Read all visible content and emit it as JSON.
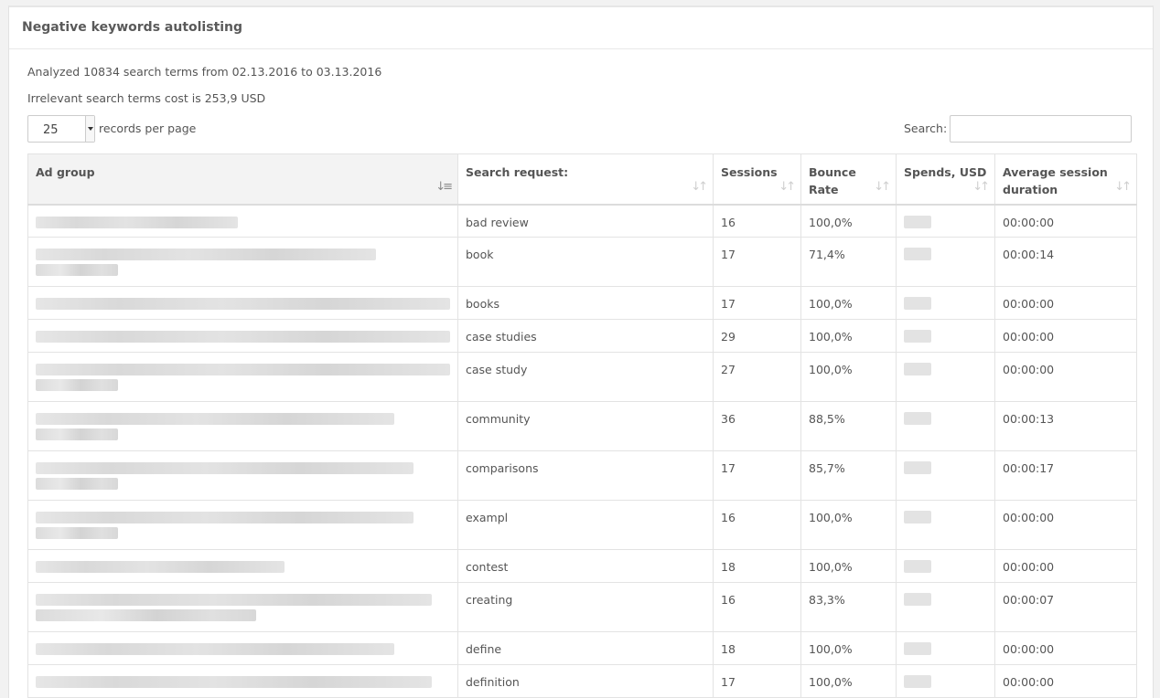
{
  "panel": {
    "title": "Negative keywords autolisting"
  },
  "summary": {
    "analyzed": "Analyzed 10834 search terms from 02.13.2016 to 03.13.2016",
    "cost": "Irrelevant search terms cost is 253,9 USD"
  },
  "length": {
    "value": "25",
    "label": "records per page"
  },
  "search": {
    "label": "Search:",
    "value": ""
  },
  "table": {
    "headers": {
      "ad_group": "Ad group",
      "search_request": "Search request:",
      "sessions": "Sessions",
      "bounce_rate": "Bounce Rate",
      "spends": "Spends, USD",
      "avg_duration": "Average session duration"
    },
    "sort_icons": {
      "sorted": "sort-amount-down-icon",
      "unsorted": "sort-both-icon"
    },
    "rows": [
      {
        "search_request": "bad review",
        "sessions": "16",
        "bounce_rate": "100,0%",
        "avg_duration": "00:00:00"
      },
      {
        "search_request": "book",
        "sessions": "17",
        "bounce_rate": "71,4%",
        "avg_duration": "00:00:14"
      },
      {
        "search_request": "books",
        "sessions": "17",
        "bounce_rate": "100,0%",
        "avg_duration": "00:00:00"
      },
      {
        "search_request": "case studies",
        "sessions": "29",
        "bounce_rate": "100,0%",
        "avg_duration": "00:00:00"
      },
      {
        "search_request": "case study",
        "sessions": "27",
        "bounce_rate": "100,0%",
        "avg_duration": "00:00:00"
      },
      {
        "search_request": "community",
        "sessions": "36",
        "bounce_rate": "88,5%",
        "avg_duration": "00:00:13"
      },
      {
        "search_request": "comparisons",
        "sessions": "17",
        "bounce_rate": "85,7%",
        "avg_duration": "00:00:17"
      },
      {
        "search_request": "exampl",
        "sessions": "16",
        "bounce_rate": "100,0%",
        "avg_duration": "00:00:00"
      },
      {
        "search_request": "contest",
        "sessions": "18",
        "bounce_rate": "100,0%",
        "avg_duration": "00:00:00"
      },
      {
        "search_request": "creating",
        "sessions": "16",
        "bounce_rate": "83,3%",
        "avg_duration": "00:00:07"
      },
      {
        "search_request": "define",
        "sessions": "18",
        "bounce_rate": "100,0%",
        "avg_duration": "00:00:00"
      },
      {
        "search_request": "definition",
        "sessions": "17",
        "bounce_rate": "100,0%",
        "avg_duration": "00:00:00"
      }
    ]
  }
}
